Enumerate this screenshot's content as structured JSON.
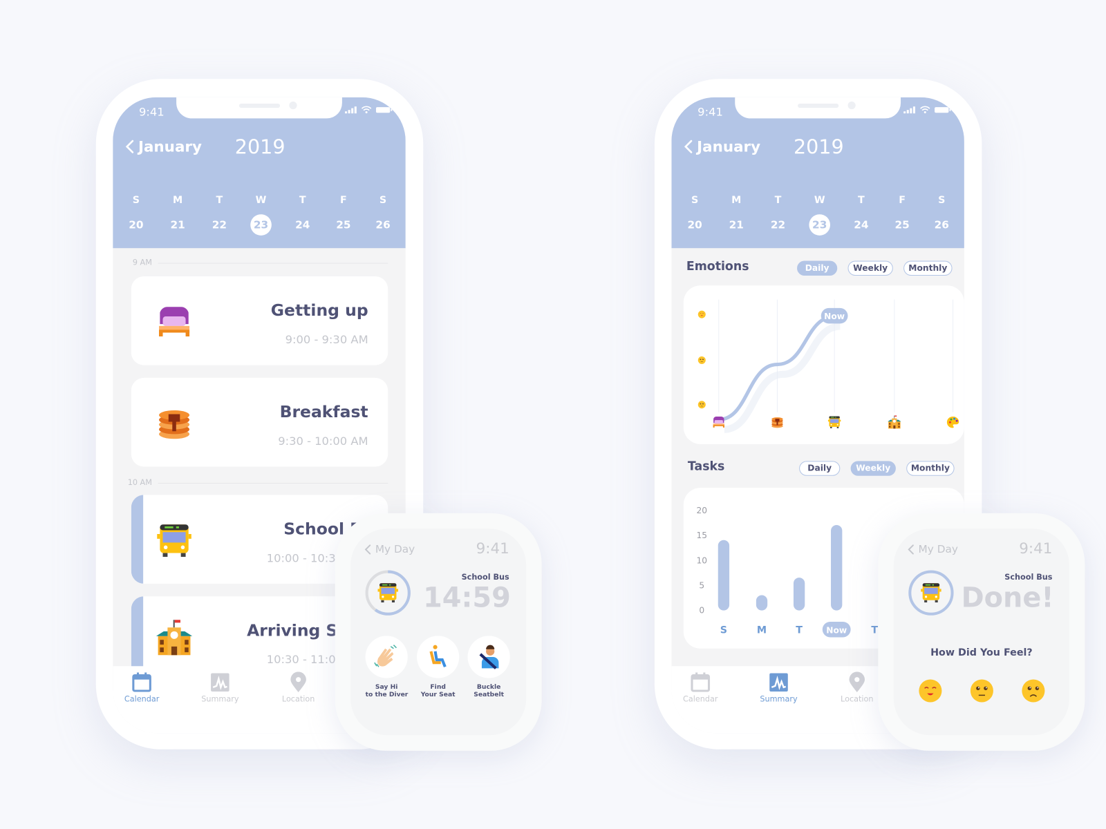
{
  "status": {
    "time": "9:41"
  },
  "calendar": {
    "month": "January",
    "year": "2019",
    "day_letters": [
      "S",
      "M",
      "T",
      "W",
      "T",
      "F",
      "S"
    ],
    "day_numbers": [
      "20",
      "21",
      "22",
      "23",
      "24",
      "25",
      "26"
    ],
    "selected": "23"
  },
  "schedule": {
    "hours": [
      "9 AM",
      "10 AM"
    ],
    "events": [
      {
        "title": "Getting up",
        "time": "9:00 - 9:30 AM",
        "icon": "bed-icon"
      },
      {
        "title": "Breakfast",
        "time": "9:30 - 10:00 AM",
        "icon": "pancakes-icon"
      },
      {
        "title": "School Bus",
        "time": "10:00 - 10:30 AM",
        "icon": "bus-icon",
        "active": true
      },
      {
        "title": "Arriving School",
        "time": "10:30 - 11:00 AM",
        "icon": "school-icon",
        "active": true
      }
    ]
  },
  "tabs": [
    {
      "label": "Calendar",
      "icon": "calendar-icon"
    },
    {
      "label": "Summary",
      "icon": "summary-chart-icon"
    },
    {
      "label": "Location",
      "icon": "location-pin-icon"
    }
  ],
  "summary": {
    "emotions": {
      "title": "Emotions",
      "filters": [
        "Daily",
        "Weekly",
        "Monthly"
      ],
      "selected": "Daily",
      "now_label": "Now"
    },
    "tasks": {
      "title": "Tasks",
      "filters": [
        "Daily",
        "Weekly",
        "Monthly"
      ],
      "selected": "Weekly"
    }
  },
  "watch_countdown": {
    "back": "My Day",
    "time": "9:41",
    "task": "School Bus",
    "timer": "14:59",
    "progress": 0.6,
    "actions": [
      "Say Hi\nto the Diver",
      "Find\nYour Seat",
      "Buckle\nSeatbelt"
    ]
  },
  "watch_done": {
    "back": "My Day",
    "time": "9:41",
    "task": "School Bus",
    "status": "Done!",
    "question": "How Did You Feel?",
    "moods": [
      "happy",
      "neutral",
      "sad"
    ]
  },
  "colors": {
    "accent": "#b3c5e6",
    "text": "#4f5275",
    "active_tab": "#6e9bd4"
  },
  "chart_data": [
    {
      "type": "line",
      "title": "Emotions",
      "y_levels": [
        "sad",
        "neutral",
        "happy"
      ],
      "x": [
        "Getting up",
        "Breakfast",
        "School Bus",
        "Arriving School",
        "Activity"
      ],
      "values": [
        0.85,
        2,
        3
      ],
      "annotation": "Now"
    },
    {
      "type": "bar",
      "title": "Tasks",
      "categories": [
        "S",
        "M",
        "T",
        "Now",
        "T"
      ],
      "values": [
        13.5,
        2.5,
        6,
        16.5
      ],
      "yticks": [
        0,
        5,
        10,
        15,
        20
      ],
      "ylim": [
        0,
        20
      ]
    }
  ]
}
